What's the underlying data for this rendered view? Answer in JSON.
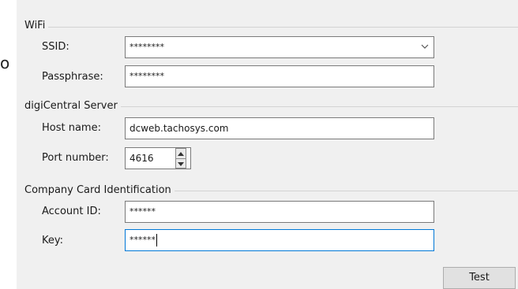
{
  "stray_glyph": "o",
  "wifi": {
    "title": "WiFi",
    "ssid_label": "SSID:",
    "ssid_value": "********",
    "passphrase_label": "Passphrase:",
    "passphrase_value": "********"
  },
  "server": {
    "title": "digiCentral Server",
    "host_label": "Host name:",
    "host_value": "dcweb.tachosys.com",
    "port_label": "Port number:",
    "port_value": "4616"
  },
  "card": {
    "title": "Company Card Identification",
    "account_label": "Account ID:",
    "account_value": "******",
    "key_label": "Key:",
    "key_value": "******"
  },
  "test_button": "Test"
}
